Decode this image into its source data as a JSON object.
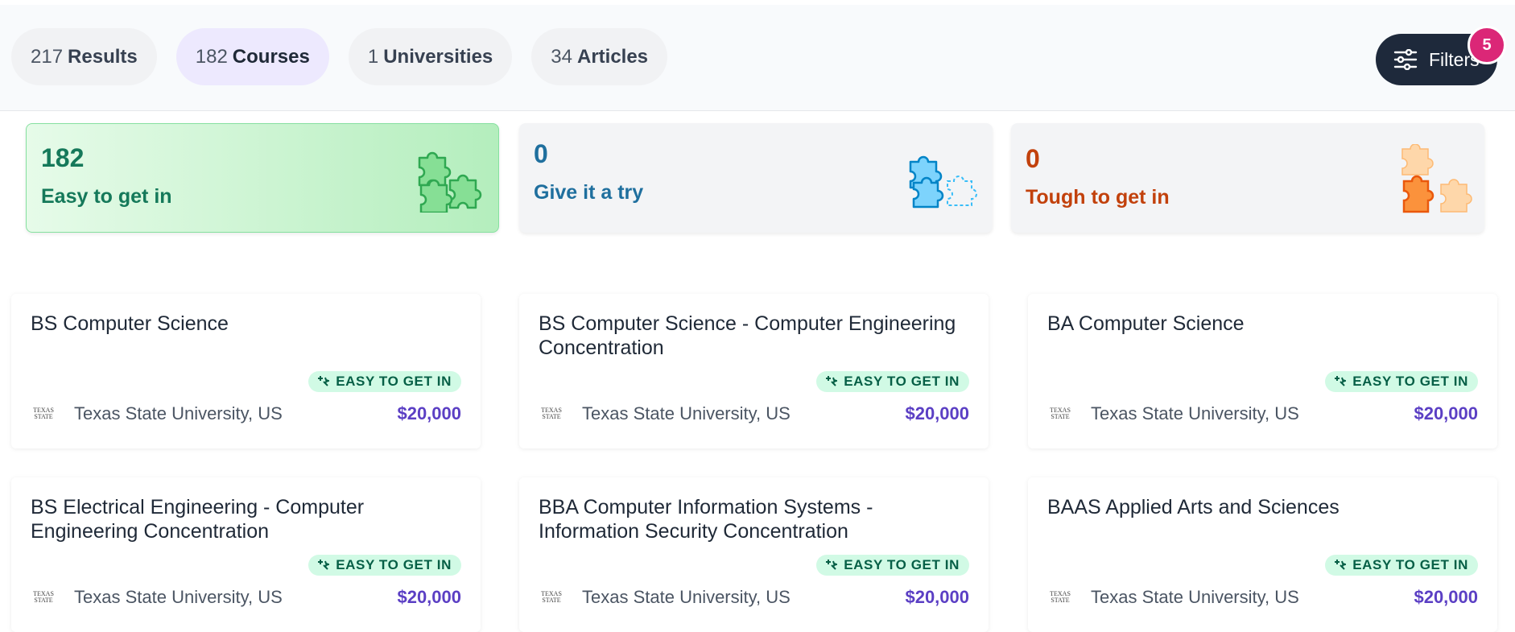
{
  "tabs": [
    {
      "count": "217",
      "label": "Results",
      "active": false
    },
    {
      "count": "182",
      "label": "Courses",
      "active": true
    },
    {
      "count": "1",
      "label": "Universities",
      "active": false
    },
    {
      "count": "34",
      "label": "Articles",
      "active": false
    }
  ],
  "filters": {
    "label": "Filters",
    "badge": "5",
    "icon": "sliders-icon"
  },
  "stats": {
    "easy": {
      "count": "182",
      "label": "Easy to get in",
      "icon": "puzzle-pieces-icon"
    },
    "try": {
      "count": "0",
      "label": "Give it a try",
      "icon": "puzzle-pieces-icon"
    },
    "tough": {
      "count": "0",
      "label": "Tough to get in",
      "icon": "puzzle-pieces-icon"
    }
  },
  "colors": {
    "accent": "#5b3fc4",
    "easy": "#15795a",
    "try": "#1f6f9e",
    "tough": "#c2410c",
    "badge": "#db2777"
  },
  "courses": [
    {
      "title": "BS Computer Science",
      "tag": "EASY TO GET IN",
      "university": "Texas State University, US",
      "fee": "$20,000"
    },
    {
      "title": "BS Computer Science - Computer Engineering Concentration",
      "tag": "EASY TO GET IN",
      "university": "Texas State University, US",
      "fee": "$20,000"
    },
    {
      "title": "BA Computer Science",
      "tag": "EASY TO GET IN",
      "university": "Texas State University, US",
      "fee": "$20,000"
    },
    {
      "title": "BS Electrical Engineering - Computer Engineering Concentration",
      "tag": "EASY TO GET IN",
      "university": "Texas State University, US",
      "fee": "$20,000"
    },
    {
      "title": "BBA Computer Information Systems - Information Security Concentration",
      "tag": "EASY TO GET IN",
      "university": "Texas State University, US",
      "fee": "$20,000"
    },
    {
      "title": "BAAS Applied Arts and Sciences",
      "tag": "EASY TO GET IN",
      "university": "Texas State University, US",
      "fee": "$20,000"
    }
  ],
  "university_logo": {
    "line1": "TEXAS",
    "line2": "STATE"
  }
}
